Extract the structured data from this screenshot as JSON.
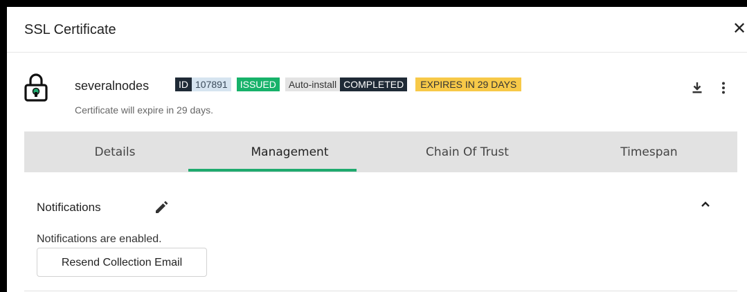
{
  "dialog": {
    "title": "SSL Certificate",
    "close_icon": "close-icon"
  },
  "certificate": {
    "name": "severalnodes",
    "id_label": "ID",
    "id_value": "107891",
    "status_badge": "ISSUED",
    "auto_install_label": "Auto-install",
    "auto_install_status": "COMPLETED",
    "expiry_badge": "EXPIRES IN 29 DAYS",
    "subtext": "Certificate will expire in 29 days.",
    "icons": {
      "lock": "lock-icon",
      "download": "download-icon",
      "menu": "more-vert-icon"
    }
  },
  "tabs": [
    {
      "label": "Details",
      "active": false
    },
    {
      "label": "Management",
      "active": true
    },
    {
      "label": "Chain Of Trust",
      "active": false
    },
    {
      "label": "Timespan",
      "active": false
    }
  ],
  "notifications": {
    "title": "Notifications",
    "status_text": "Notifications are enabled.",
    "resend_label": "Resend Collection Email",
    "icons": {
      "edit": "pencil-icon",
      "collapse": "chevron-up-icon"
    }
  },
  "colors": {
    "accent": "#1faa6e",
    "issued": "#17b26a",
    "expires": "#f7c948",
    "dark_badge": "#1f2a36",
    "tab_bg": "#e2e2e2"
  }
}
